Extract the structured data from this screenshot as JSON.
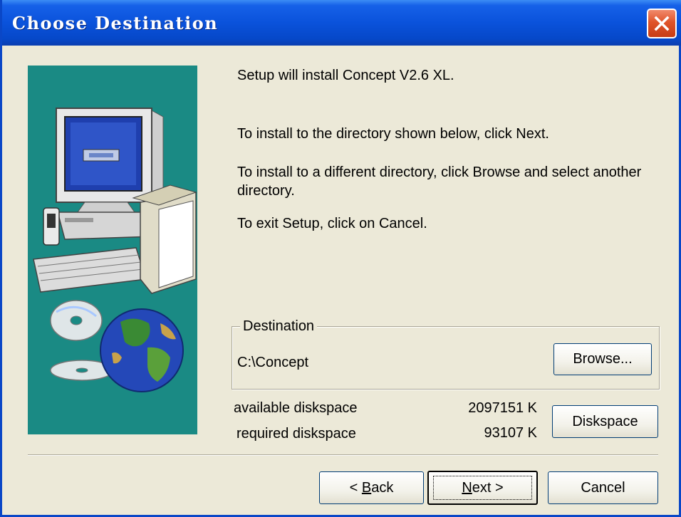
{
  "window": {
    "title": "Choose Destination"
  },
  "body": {
    "line1": "Setup will install Concept V2.6 XL.",
    "line2": "To install to the directory shown below, click Next.",
    "line3": "To install to a different directory, click Browse and select another directory.",
    "line4": "To exit Setup, click on Cancel."
  },
  "destination": {
    "legend": "Destination",
    "path": "C:\\Concept",
    "browse_label": "Browse..."
  },
  "diskspace": {
    "available_label": "available diskspace",
    "available_value": "2097151 K",
    "required_label": "required diskspace",
    "required_value": "93107 K",
    "button_label": "Diskspace"
  },
  "buttons": {
    "back_prefix": "< ",
    "back_mnemonic": "B",
    "back_rest": "ack",
    "next_mnemonic": "N",
    "next_rest": "ext >",
    "cancel": "Cancel"
  },
  "colors": {
    "titlebar": "#0a52db",
    "image_background": "#1a8a84",
    "dialog_background": "#ece9d8"
  },
  "icons": [
    "close-icon",
    "computer-illustration",
    "cd-disc-illustration",
    "globe-illustration"
  ]
}
